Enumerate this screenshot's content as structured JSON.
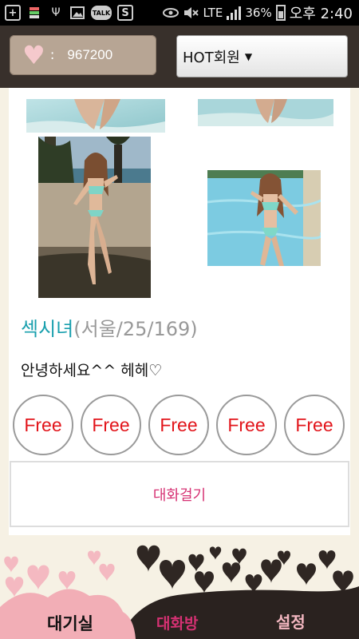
{
  "status_bar": {
    "signal_label": "LTE",
    "battery": "36%",
    "time": "오후 2:40",
    "icons": [
      "plus-icon",
      "flag-icon",
      "usb-icon",
      "image-icon",
      "talk-icon",
      "s-icon",
      "eye-icon",
      "mute-icon",
      "signal-icon",
      "battery-icon"
    ]
  },
  "header": {
    "points_colon": ":",
    "points": "967200",
    "member_select": "HOT회원",
    "caret": "▼"
  },
  "profile": {
    "name": "섹시녀",
    "meta": "(서울/25/169)",
    "greeting": "안녕하세요^^ 헤헤♡",
    "free_labels": [
      "Free",
      "Free",
      "Free",
      "Free",
      "Free"
    ],
    "chat_button": "대화걸기"
  },
  "bottom_nav": {
    "tab_wait": "대기실",
    "tab_chat": "대화방",
    "tab_settings": "설정"
  },
  "colors": {
    "accent_name": "#1aa0ae",
    "free": "#e2151b",
    "chat": "#d63173",
    "header_bg": "#38302b"
  }
}
